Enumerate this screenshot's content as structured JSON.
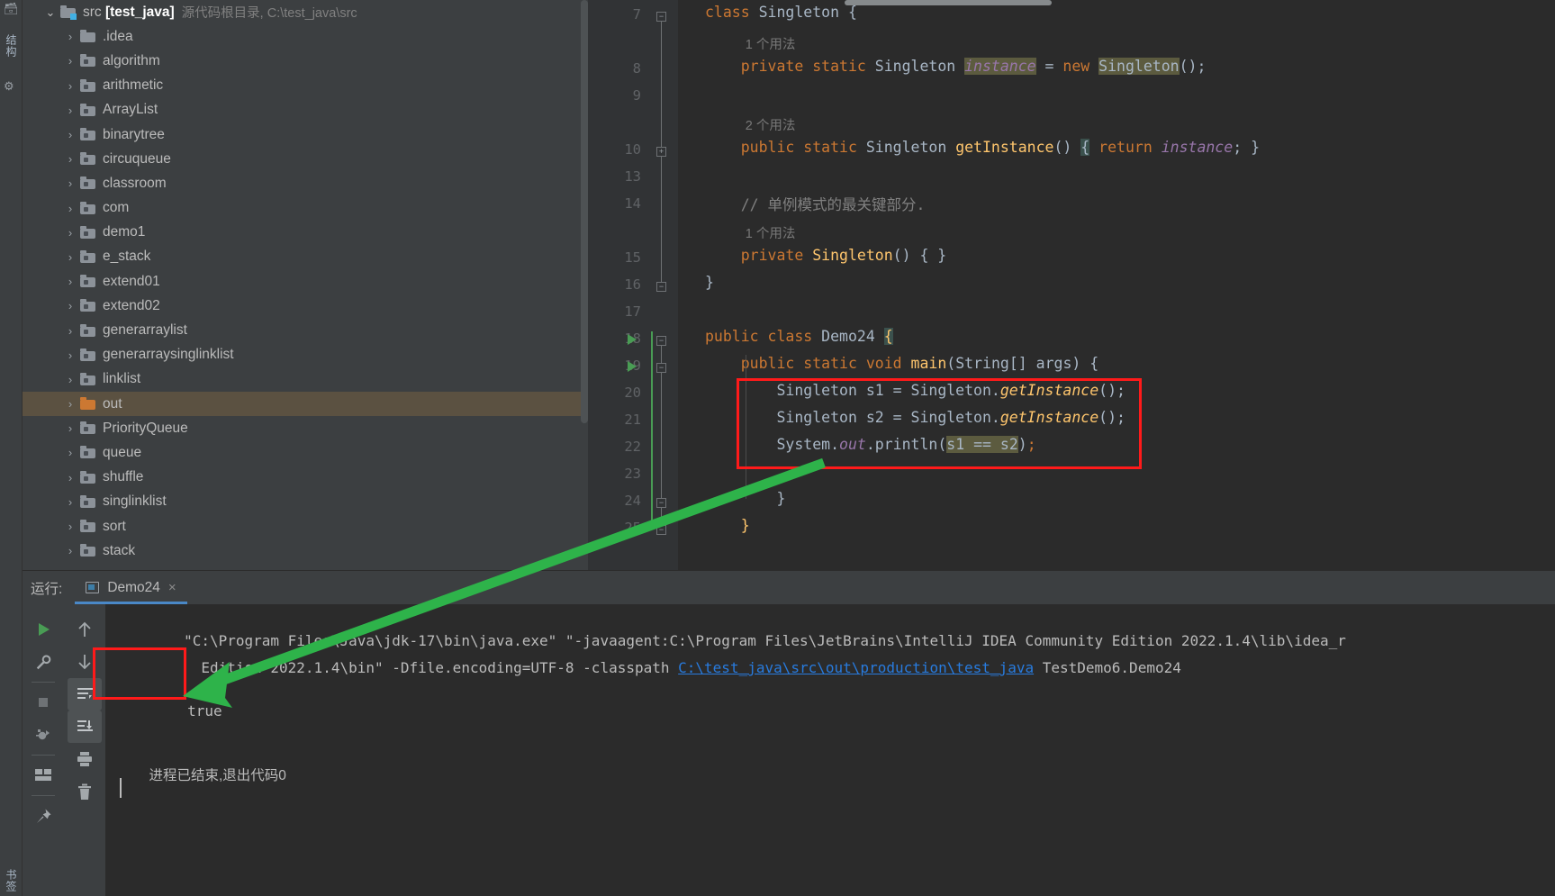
{
  "left_strip": {
    "project_tab": "项目",
    "structure_tab": "结构",
    "bookmarks_tab": "书签"
  },
  "tree": {
    "root": {
      "name": "src",
      "module": "[test_java]",
      "description": "源代码根目录, C:\\test_java\\src",
      "expanded": true
    },
    "items": [
      {
        "label": ".idea",
        "kind": "plain"
      },
      {
        "label": "algorithm",
        "kind": "module"
      },
      {
        "label": "arithmetic",
        "kind": "module"
      },
      {
        "label": "ArrayList",
        "kind": "module"
      },
      {
        "label": "binarytree",
        "kind": "module"
      },
      {
        "label": "circuqueue",
        "kind": "module"
      },
      {
        "label": "classroom",
        "kind": "module"
      },
      {
        "label": "com",
        "kind": "module"
      },
      {
        "label": "demo1",
        "kind": "module"
      },
      {
        "label": "e_stack",
        "kind": "module"
      },
      {
        "label": "extend01",
        "kind": "module"
      },
      {
        "label": "extend02",
        "kind": "module"
      },
      {
        "label": "generarraylist",
        "kind": "module"
      },
      {
        "label": "generarraysinglinklist",
        "kind": "module"
      },
      {
        "label": "linklist",
        "kind": "module"
      },
      {
        "label": "out",
        "kind": "out",
        "selected": true
      },
      {
        "label": "PriorityQueue",
        "kind": "module"
      },
      {
        "label": "queue",
        "kind": "module"
      },
      {
        "label": "shuffle",
        "kind": "module"
      },
      {
        "label": "singlinklist",
        "kind": "module"
      },
      {
        "label": "sort",
        "kind": "module"
      },
      {
        "label": "stack",
        "kind": "module"
      }
    ]
  },
  "editor": {
    "line_numbers": [
      "7",
      "8",
      "9",
      "10",
      "13",
      "14",
      "15",
      "16",
      "17",
      "18",
      "19",
      "20",
      "21",
      "22",
      "23",
      "24",
      "25"
    ],
    "inlay_hints": [
      {
        "text": "1 个用法",
        "line_after": "7"
      },
      {
        "text": "2 个用法",
        "line_after": "9"
      },
      {
        "text": "1 个用法",
        "line_after": "14"
      }
    ],
    "lines": [
      {
        "num": "7",
        "text": "class Singleton {"
      },
      {
        "num": "8",
        "text": "    private static Singleton instance = new Singleton();"
      },
      {
        "num": "9",
        "text": ""
      },
      {
        "num": "10",
        "text": "    public static Singleton getInstance() { return instance; }"
      },
      {
        "num": "13",
        "text": ""
      },
      {
        "num": "14",
        "text": "    // 单例模式的最关键部分."
      },
      {
        "num": "15",
        "text": "    private Singleton() { }"
      },
      {
        "num": "16",
        "text": "}"
      },
      {
        "num": "17",
        "text": ""
      },
      {
        "num": "18",
        "text": "public class Demo24 {"
      },
      {
        "num": "19",
        "text": "    public static void main(String[] args) {"
      },
      {
        "num": "20",
        "text": "        Singleton s1 = Singleton.getInstance();"
      },
      {
        "num": "21",
        "text": "        Singleton s2 = Singleton.getInstance();"
      },
      {
        "num": "22",
        "text": "        System.out.println(s1 == s2);"
      },
      {
        "num": "23",
        "text": ""
      },
      {
        "num": "24",
        "text": "    }"
      },
      {
        "num": "25",
        "text": "}"
      }
    ],
    "comment_text": "// 单例模式的最关键部分.",
    "colors": {
      "keyword": "#cc7832",
      "method": "#ffc66d",
      "field": "#9876aa",
      "text": "#a9b7c6",
      "comment": "#808080",
      "highlight_bg": "#5c5b3f",
      "background": "#2b2b2b",
      "gutter": "#313335"
    }
  },
  "run_panel": {
    "label": "运行:",
    "tab": {
      "name": "Demo24",
      "close": "×"
    },
    "toolbar_left": [
      {
        "name": "rerun-button",
        "icon": "run-icon"
      },
      {
        "name": "settings-button",
        "icon": "wrench-icon"
      },
      {
        "name": "stop-button",
        "icon": "stop-icon"
      },
      {
        "name": "rerun-failed-button",
        "icon": "bug-icon"
      },
      {
        "name": "layout-button",
        "icon": "layout-icon"
      },
      {
        "name": "pin-button",
        "icon": "pin-icon"
      }
    ],
    "toolbar_right": [
      {
        "name": "up-button",
        "icon": "arrow-up-icon"
      },
      {
        "name": "down-button",
        "icon": "arrow-down-icon"
      },
      {
        "name": "soft-wrap-button",
        "icon": "soft-wrap-icon"
      },
      {
        "name": "scroll-end-button",
        "icon": "scroll-to-end-icon"
      },
      {
        "name": "print-button",
        "icon": "print-icon"
      },
      {
        "name": "clear-button",
        "icon": "trash-icon"
      }
    ],
    "console": {
      "line1_a": "\"C:\\Program Files\\Java\\jdk-17\\bin\\java.exe\" \"-javaagent:C:\\Program Files\\JetBrains\\IntelliJ IDEA Community Edition 2022.1.4\\lib\\idea_r",
      "line2_a": "  Edition 2022.1.4\\bin\" -Dfile.encoding=UTF-8 -classpath ",
      "line2_link": "C:\\test_java\\src\\out\\production\\test_java",
      "line2_b": " TestDemo6.Demo24",
      "output": "true",
      "exit_message": "进程已结束,退出代码0"
    }
  },
  "annotations": {
    "code_box_color": "#ff1a1a",
    "output_box_color": "#ff1a1a",
    "arrow_color": "#2eb34a"
  }
}
